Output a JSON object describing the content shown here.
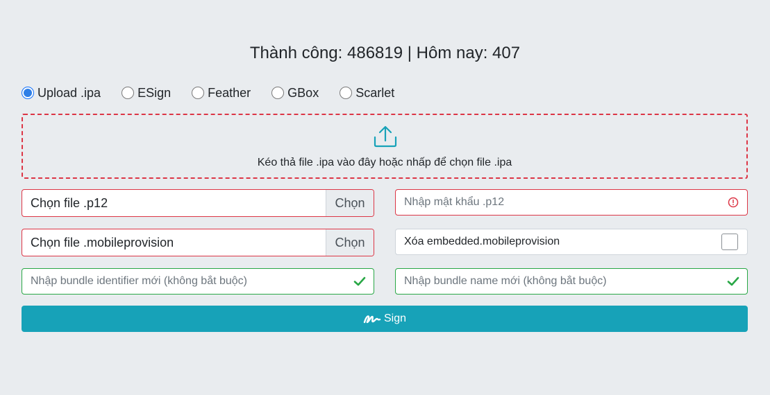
{
  "stats": {
    "success_label": "Thành công:",
    "success_count": "486819",
    "separator": "|",
    "today_label": "Hôm nay:",
    "today_count": "407"
  },
  "modes": {
    "selected": "Upload .ipa",
    "options": [
      "Upload .ipa",
      "ESign",
      "Feather",
      "GBox",
      "Scarlet"
    ]
  },
  "dropzone": {
    "icon": "upload-icon",
    "text": "Kéo thả file .ipa vào đây hoặc nhấp để chọn file .ipa"
  },
  "p12": {
    "file_text": "Chọn file .p12",
    "button_label": "Chọn"
  },
  "password": {
    "placeholder": "Nhập mật khẩu .p12",
    "status_icon": "error-circle-icon"
  },
  "mobileprovision": {
    "file_text": "Chọn file .mobileprovision",
    "button_label": "Chọn"
  },
  "remove_embedded": {
    "label": "Xóa embedded.mobileprovision",
    "checked": false
  },
  "bundle_id": {
    "placeholder": "Nhập bundle identifier mới (không bắt buộc)",
    "status_icon": "checkmark-icon"
  },
  "bundle_name": {
    "placeholder": "Nhập bundle name mới (không bắt buộc)",
    "status_icon": "checkmark-icon"
  },
  "sign_button": {
    "label": "Sign",
    "icon": "signature-icon"
  },
  "colors": {
    "background": "#e9ecef",
    "invalid": "#dc3545",
    "valid": "#28a745",
    "primary_button": "#17a2b8",
    "radio_checked": "#2f7fe6"
  }
}
